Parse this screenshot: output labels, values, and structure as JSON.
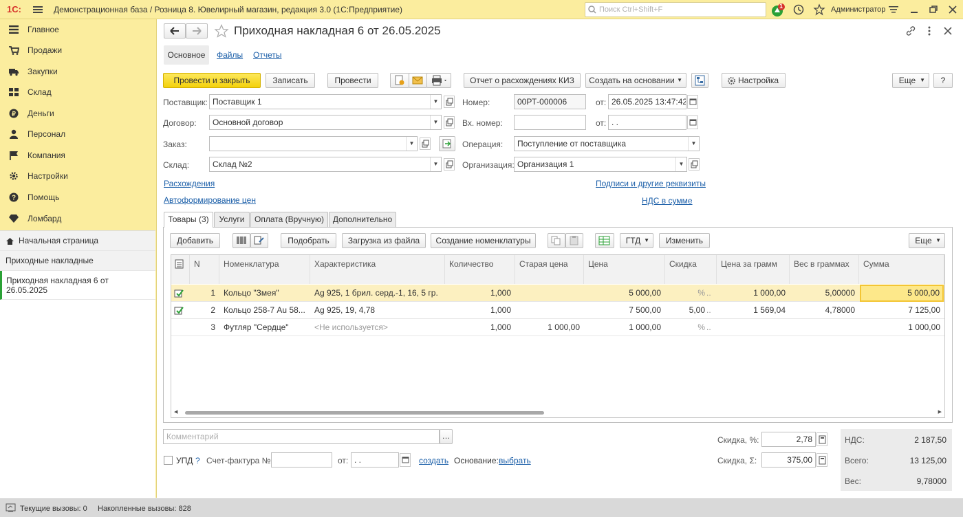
{
  "app": {
    "logo": "1С:",
    "title": "Демонстрационная база / Розница 8. Ювелирный магазин, редакция 3.0  (1С:Предприятие)",
    "search_placeholder": "Поиск Ctrl+Shift+F",
    "notification_count": "1",
    "user": "Администратор"
  },
  "sidebar": {
    "items": [
      {
        "label": "Главное",
        "icon": "list-icon"
      },
      {
        "label": "Продажи",
        "icon": "cart-icon"
      },
      {
        "label": "Закупки",
        "icon": "truck-icon"
      },
      {
        "label": "Склад",
        "icon": "grid-icon"
      },
      {
        "label": "Деньги",
        "icon": "money-icon"
      },
      {
        "label": "Персонал",
        "icon": "person-icon"
      },
      {
        "label": "Компания",
        "icon": "flag-icon"
      },
      {
        "label": "Настройки",
        "icon": "gear-icon"
      },
      {
        "label": "Помощь",
        "icon": "help-icon"
      },
      {
        "label": "Ломбард",
        "icon": "diamond-icon"
      }
    ],
    "home": "Начальная страница",
    "open_list": "Приходные накладные",
    "current_doc": "Приходная накладная 6 от 26.05.2025"
  },
  "doc": {
    "title": "Приходная накладная 6 от 26.05.2025",
    "subtabs": [
      "Основное",
      "Файлы",
      "Отчеты"
    ]
  },
  "toolbar": {
    "post_close": "Провести и закрыть",
    "save": "Записать",
    "post": "Провести",
    "kiz_report": "Отчет о расхождениях КИЗ",
    "create_based": "Создать на основании",
    "settings": "Настройка",
    "more": "Еще",
    "help": "?"
  },
  "form": {
    "supplier_label": "Поставщик:",
    "supplier": "Поставщик 1",
    "contract_label": "Договор:",
    "contract": "Основной договор",
    "order_label": "Заказ:",
    "order": "",
    "warehouse_label": "Склад:",
    "warehouse": "Склад №2",
    "number_label": "Номер:",
    "number": "00РТ-000006",
    "from_label": "от:",
    "date": "26.05.2025 13:47:42",
    "in_number_label": "Вх. номер:",
    "in_number": "",
    "in_date": " .  .",
    "operation_label": "Операция:",
    "operation": "Поступление от поставщика",
    "org_label": "Организация:",
    "org": "Организация 1",
    "link_discrepancy": "Расхождения",
    "link_autoprice": "Автоформирование цен",
    "link_signatures": "Подписи и другие реквизиты",
    "link_vat": "НДС в сумме"
  },
  "tabs": [
    "Товары (3)",
    "Услуги",
    "Оплата (Вручную)",
    "Дополнительно"
  ],
  "table_toolbar": {
    "add": "Добавить",
    "pick": "Подобрать",
    "load_file": "Загрузка из файла",
    "create_items": "Создание номенклатуры",
    "gtd": "ГТД",
    "change": "Изменить",
    "more": "Еще"
  },
  "table": {
    "columns": [
      "N",
      "Номенклатура",
      "Характеристика",
      "Количество",
      "Старая цена",
      "Цена",
      "Скидка",
      "Цена за грамм",
      "Вес в граммах",
      "Сумма"
    ],
    "rows": [
      {
        "n": "1",
        "item": "Кольцо \"Змея\"",
        "char": "Ag 925, 1 брил. серд.-1, 16, 5 гр.",
        "qty": "1,000",
        "old_price": "",
        "price": "5 000,00",
        "disc": "%",
        "disc2": "..",
        "ppg": "1 000,00",
        "weight": "5,00000",
        "sum": "5 000,00"
      },
      {
        "n": "2",
        "item": "Кольцо 258-7 Au 58...",
        "char": "Ag 925, 19, 4,78",
        "qty": "1,000",
        "old_price": "",
        "price": "7 500,00",
        "disc": "5,00",
        "disc2": "..",
        "ppg": "1 569,04",
        "weight": "4,78000",
        "sum": "7 125,00"
      },
      {
        "n": "3",
        "item": "Футляр \"Сердце\"",
        "char": "<Не используется>",
        "qty": "1,000",
        "old_price": "1 000,00",
        "price": "1 000,00",
        "disc": "%",
        "disc2": "..",
        "ppg": "",
        "weight": "",
        "sum": "1 000,00"
      }
    ]
  },
  "footer": {
    "comment_placeholder": "Комментарий",
    "upd": "УПД",
    "upd_help": "?",
    "invoice_label": "Счет-фактура №:",
    "invoice_from": "от:",
    "invoice_date": " .  .",
    "create_link": "создать",
    "basis_label": "Основание:",
    "basis_link": "выбрать",
    "discount_pct_label": "Скидка, %:",
    "discount_pct": "2,78",
    "discount_sum_label": "Скидка, Σ:",
    "discount_sum": "375,00",
    "vat_label": "НДС:",
    "vat": "2 187,50",
    "total_label": "Всего:",
    "total": "13 125,00",
    "weight_label": "Вес:",
    "weight": "9,78000"
  },
  "status": {
    "current_calls": "Текущие вызовы: 0",
    "accum_calls": "Накопленные вызовы: 828"
  },
  "colors": {
    "topbar": "#fbed9e",
    "accent_button": "#f4d10b",
    "link": "#1a5ea8",
    "selected_row": "#fcf0c0"
  }
}
